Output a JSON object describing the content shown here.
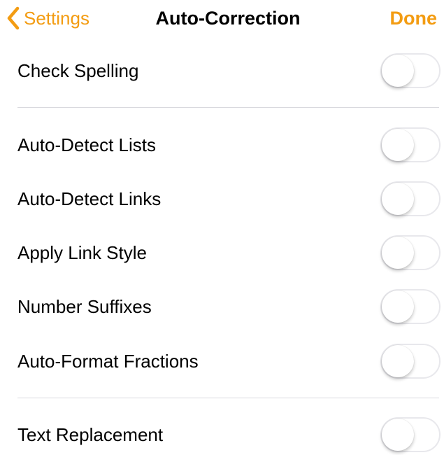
{
  "nav": {
    "back_label": "Settings",
    "title": "Auto-Correction",
    "done_label": "Done"
  },
  "colors": {
    "accent": "#f39c12",
    "toggle_border": "#e8e8ec",
    "separator": "#d9d9de"
  },
  "rows": [
    {
      "label": "Check Spelling",
      "enabled": false
    },
    {
      "label": "Auto-Detect Lists",
      "enabled": false
    },
    {
      "label": "Auto-Detect Links",
      "enabled": false
    },
    {
      "label": "Apply Link Style",
      "enabled": false
    },
    {
      "label": "Number Suffixes",
      "enabled": false
    },
    {
      "label": "Auto-Format Fractions",
      "enabled": false
    },
    {
      "label": "Text Replacement",
      "enabled": false
    }
  ]
}
